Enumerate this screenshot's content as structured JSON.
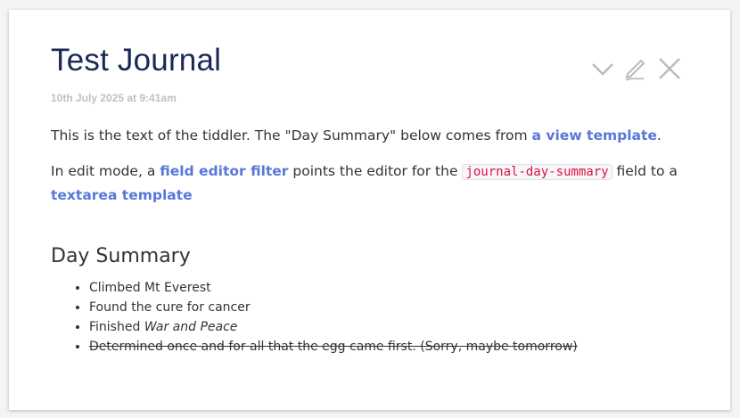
{
  "tiddler": {
    "title": "Test Journal",
    "subtitle": "10th July 2025 at 9:41am",
    "controls": {
      "fold_icon": "chevron-down-icon",
      "edit_icon": "pencil-icon",
      "close_icon": "close-icon"
    },
    "paragraph1": {
      "text_before": "This is the text of the tiddler. The \"Day Summary\" below comes from ",
      "link": "a view template",
      "text_after": "."
    },
    "paragraph2": {
      "text_before": "In edit mode, a ",
      "link1": "field editor filter",
      "text_middle": " points the editor for the ",
      "code": "journal-day-summary",
      "text_after": " field to a ",
      "link2": "textarea template"
    },
    "day_summary": {
      "heading": "Day Summary",
      "items": [
        {
          "text": "Climbed Mt Everest"
        },
        {
          "text": "Found the cure for cancer"
        },
        {
          "prefix": "Finished ",
          "italic": "War and Peace"
        },
        {
          "text": "Determined once and for all that the egg came first. (Sorry, maybe tomorrow)",
          "struck": true
        }
      ]
    }
  },
  "colors": {
    "title": "#182955",
    "link": "#5778d8",
    "code": "#dd1144",
    "subtitle": "#c0c0c0",
    "icons": "#bbbbbb"
  }
}
